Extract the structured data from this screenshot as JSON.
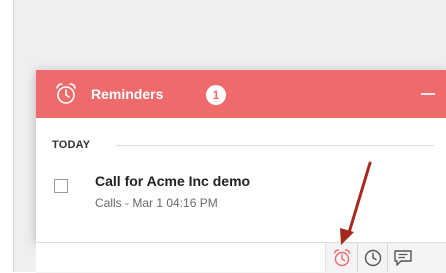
{
  "panel": {
    "title": "Reminders",
    "count": "1"
  },
  "section": {
    "title": "TODAY"
  },
  "reminders": [
    {
      "title": "Call for Acme Inc demo",
      "meta": "Calls - Mar 1 04:16 PM"
    }
  ],
  "icons": {
    "header": "alarm-clock-icon",
    "minimize": "minimize-icon",
    "footer": [
      "alarm-clock-icon",
      "clock-icon",
      "chat-icon"
    ]
  },
  "colors": {
    "accent": "#ef6b6b",
    "annotation_arrow": "#a6291f"
  }
}
